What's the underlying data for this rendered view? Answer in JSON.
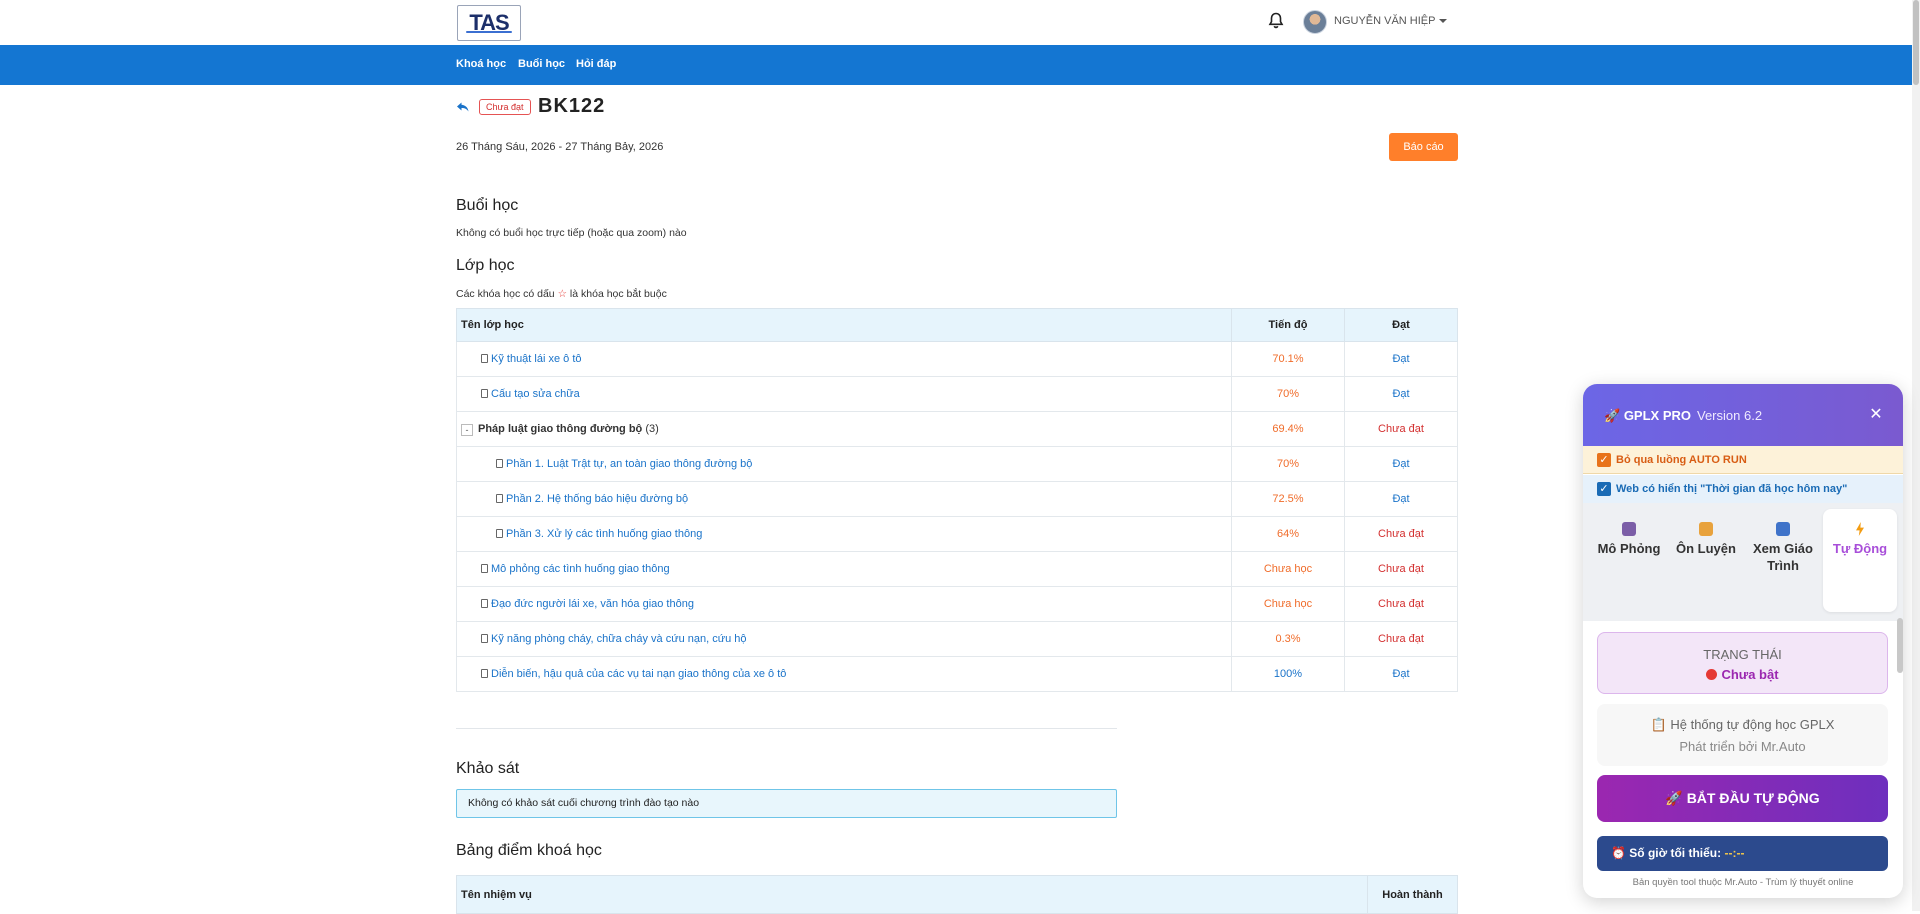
{
  "header": {
    "logo_text": "TAS",
    "user_name": "NGUYỄN VĂN HIỆP"
  },
  "nav": {
    "items": [
      "Khoá học",
      "Buổi học",
      "Hỏi đáp"
    ]
  },
  "course": {
    "status_badge": "Chưa đạt",
    "code": "BK122",
    "date_range": "26 Tháng Sáu, 2026 - 27 Tháng Bảy, 2026",
    "report_button": "Báo cáo"
  },
  "sessions": {
    "title": "Buổi học",
    "empty_text": "Không có buổi học trực tiếp (hoặc qua zoom) nào"
  },
  "classes": {
    "title": "Lớp học",
    "note_before": "Các khóa học có dấu",
    "note_star": "☆",
    "note_after": "là khóa học bắt buộc",
    "headers": [
      "Tên lớp học",
      "Tiến độ",
      "Đạt"
    ],
    "rows": [
      {
        "name": "Kỹ thuật lái xe ô tô",
        "progress": "70.1%",
        "result": "Đạt"
      },
      {
        "name": "Cấu tạo sửa chữa",
        "progress": "70%",
        "result": "Đạt"
      },
      {
        "name": "Pháp luật giao thông đường bộ",
        "count": "(3)",
        "progress": "69.4%",
        "result": "Chưa đạt"
      },
      {
        "name": "Phần 1. Luật Trật tự, an toàn giao thông đường bộ",
        "progress": "70%",
        "result": "Đạt"
      },
      {
        "name": "Phần 2. Hệ thống báo hiệu đường bộ",
        "progress": "72.5%",
        "result": "Đạt"
      },
      {
        "name": "Phần 3. Xử lý các tình huống giao thông",
        "progress": "64%",
        "result": "Chưa đạt"
      },
      {
        "name": "Mô phỏng các tình huống giao thông",
        "progress": "Chưa học",
        "result": "Chưa đạt"
      },
      {
        "name": "Đạo đức người lái xe, văn hóa giao thông",
        "progress": "Chưa học",
        "result": "Chưa đạt"
      },
      {
        "name": "Kỹ năng phòng cháy, chữa cháy và cứu nạn, cứu hộ",
        "progress": "0.3%",
        "result": "Chưa đạt"
      },
      {
        "name": "Diễn biến, hậu quả của các vụ tai nạn giao thông của xe ô tô",
        "progress": "100%",
        "result": "Đạt"
      }
    ]
  },
  "survey": {
    "title": "Khảo sát",
    "empty_text": "Không có khảo sát cuối chương trình đào tạo nào"
  },
  "scores": {
    "title": "Bảng điểm khoá học",
    "headers": [
      "Tên nhiệm vụ",
      "Hoàn thành"
    ]
  },
  "panel": {
    "title": "GPLX PRO",
    "version": "Version 6.2",
    "option1": "Bỏ qua luồng AUTO RUN",
    "option2": "Web có hiển thị \"Thời gian đã học hôm nay\"",
    "tabs": [
      {
        "label": "Mô Phỏng"
      },
      {
        "label": "Ôn Luyện"
      },
      {
        "label": "Xem Giáo Trình"
      },
      {
        "label": "Tự Động"
      }
    ],
    "status_label": "TRẠNG THÁI",
    "status_value": "Chưa bật",
    "info_line1": "Hệ thống tự động học GPLX",
    "info_line2": "Phát triển bởi Mr.Auto",
    "start_button": "BẮT ĐẦU TỰ ĐỘNG",
    "min_hours_label": "Số giờ tối thiểu:",
    "min_hours_value": "--:--",
    "copyright": "Bản quyền tool thuộc Mr.Auto - Trùm lý thuyết online"
  },
  "colors": {
    "nav_blue": "#1476d2",
    "report_orange": "#ff7f2a",
    "fail_red": "#d32f2f",
    "progress_orange": "#f06c2a",
    "link_blue": "#1a73c9",
    "panel_purple": "#7a5ad0"
  }
}
